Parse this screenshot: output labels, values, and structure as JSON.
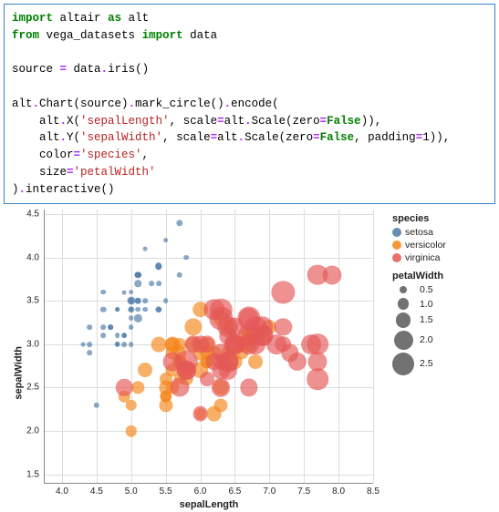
{
  "code": {
    "tokens": [
      [
        [
          "import",
          "kw"
        ],
        [
          " "
        ],
        [
          "altair",
          "name"
        ],
        [
          " "
        ],
        [
          "as",
          "kw"
        ],
        [
          " "
        ],
        [
          "alt",
          "name"
        ]
      ],
      [
        [
          "from",
          "kw"
        ],
        [
          " "
        ],
        [
          "vega_datasets",
          "name"
        ],
        [
          " "
        ],
        [
          "import",
          "kw"
        ],
        [
          " "
        ],
        [
          "data",
          "name"
        ]
      ],
      [],
      [
        [
          "source "
        ],
        [
          "=",
          "op"
        ],
        [
          " data"
        ],
        [
          ".",
          "op"
        ],
        [
          "iris()"
        ]
      ],
      [],
      [
        [
          "alt"
        ],
        [
          ".",
          "op"
        ],
        [
          "Chart(source)"
        ],
        [
          ".",
          "op"
        ],
        [
          "mark_circle()"
        ],
        [
          ".",
          "op"
        ],
        [
          "encode("
        ]
      ],
      [
        [
          "    alt"
        ],
        [
          ".",
          "op"
        ],
        [
          "X("
        ],
        [
          "'sepalLength'",
          "str"
        ],
        [
          ", scale"
        ],
        [
          "=",
          "op"
        ],
        [
          "alt"
        ],
        [
          ".",
          "op"
        ],
        [
          "Scale(zero"
        ],
        [
          "=",
          "op"
        ],
        [
          "False",
          "bool"
        ],
        [
          ")),"
        ]
      ],
      [
        [
          "    alt"
        ],
        [
          ".",
          "op"
        ],
        [
          "Y("
        ],
        [
          "'sepalWidth'",
          "str"
        ],
        [
          ", scale"
        ],
        [
          "=",
          "op"
        ],
        [
          "alt"
        ],
        [
          ".",
          "op"
        ],
        [
          "Scale(zero"
        ],
        [
          "=",
          "op"
        ],
        [
          "False",
          "bool"
        ],
        [
          ", padding"
        ],
        [
          "=",
          "op"
        ],
        [
          "1",
          "num"
        ],
        [
          ")),"
        ]
      ],
      [
        [
          "    color"
        ],
        [
          "=",
          "op"
        ],
        [
          "'species'",
          "str"
        ],
        [
          ","
        ]
      ],
      [
        [
          "    size"
        ],
        [
          "=",
          "op"
        ],
        [
          "'petalWidth'",
          "str"
        ]
      ],
      [
        [
          ")"
        ],
        [
          ".",
          "op"
        ],
        [
          "interactive()"
        ]
      ]
    ]
  },
  "chart_data": {
    "type": "scatter",
    "xlabel": "sepalLength",
    "ylabel": "sepalWidth",
    "x_ticks": [
      4.0,
      4.5,
      5.0,
      5.5,
      6.0,
      6.5,
      7.0,
      7.5,
      8.0,
      8.5
    ],
    "y_ticks": [
      1.5,
      2.0,
      2.5,
      3.0,
      3.5,
      4.0,
      4.5
    ],
    "xlim": [
      3.75,
      8.5
    ],
    "ylim": [
      1.4,
      4.55
    ],
    "color_field": "species",
    "size_field": "petalWidth",
    "colors": {
      "setosa": "#4c78a8",
      "versicolor": "#f58518",
      "virginica": "#e45756"
    },
    "legend_color": {
      "title": "species",
      "items": [
        "setosa",
        "versicolor",
        "virginica"
      ]
    },
    "legend_size": {
      "title": "petalWidth",
      "items": [
        0.5,
        1.0,
        1.5,
        2.0,
        2.5
      ]
    },
    "series": [
      {
        "species": "setosa",
        "color": "#4c78a8",
        "points": [
          [
            5.1,
            3.5,
            0.2
          ],
          [
            4.9,
            3.0,
            0.2
          ],
          [
            4.7,
            3.2,
            0.2
          ],
          [
            4.6,
            3.1,
            0.2
          ],
          [
            5.0,
            3.6,
            0.2
          ],
          [
            5.4,
            3.9,
            0.4
          ],
          [
            4.6,
            3.4,
            0.3
          ],
          [
            5.0,
            3.4,
            0.2
          ],
          [
            4.4,
            2.9,
            0.2
          ],
          [
            4.9,
            3.1,
            0.1
          ],
          [
            5.4,
            3.7,
            0.2
          ],
          [
            4.8,
            3.4,
            0.2
          ],
          [
            4.8,
            3.0,
            0.1
          ],
          [
            4.3,
            3.0,
            0.1
          ],
          [
            5.8,
            4.0,
            0.2
          ],
          [
            5.7,
            4.4,
            0.4
          ],
          [
            5.4,
            3.9,
            0.4
          ],
          [
            5.1,
            3.5,
            0.3
          ],
          [
            5.7,
            3.8,
            0.3
          ],
          [
            5.1,
            3.8,
            0.3
          ],
          [
            5.4,
            3.4,
            0.2
          ],
          [
            5.1,
            3.7,
            0.4
          ],
          [
            4.6,
            3.6,
            0.2
          ],
          [
            5.1,
            3.3,
            0.5
          ],
          [
            4.8,
            3.4,
            0.2
          ],
          [
            5.0,
            3.0,
            0.2
          ],
          [
            5.0,
            3.4,
            0.4
          ],
          [
            5.2,
            3.5,
            0.2
          ],
          [
            5.2,
            3.4,
            0.2
          ],
          [
            4.7,
            3.2,
            0.2
          ],
          [
            4.8,
            3.1,
            0.2
          ],
          [
            5.4,
            3.4,
            0.4
          ],
          [
            5.2,
            4.1,
            0.1
          ],
          [
            5.5,
            4.2,
            0.2
          ],
          [
            4.9,
            3.1,
            0.2
          ],
          [
            5.0,
            3.2,
            0.2
          ],
          [
            5.5,
            3.5,
            0.2
          ],
          [
            4.9,
            3.6,
            0.1
          ],
          [
            4.4,
            3.0,
            0.2
          ],
          [
            5.1,
            3.4,
            0.2
          ],
          [
            5.0,
            3.5,
            0.3
          ],
          [
            4.5,
            2.3,
            0.3
          ],
          [
            4.4,
            3.2,
            0.2
          ],
          [
            5.0,
            3.5,
            0.6
          ],
          [
            5.1,
            3.8,
            0.4
          ],
          [
            4.8,
            3.0,
            0.3
          ],
          [
            5.1,
            3.8,
            0.2
          ],
          [
            4.6,
            3.2,
            0.2
          ],
          [
            5.3,
            3.7,
            0.2
          ],
          [
            5.0,
            3.3,
            0.2
          ]
        ]
      },
      {
        "species": "versicolor",
        "color": "#f58518",
        "points": [
          [
            7.0,
            3.2,
            1.4
          ],
          [
            6.4,
            3.2,
            1.5
          ],
          [
            6.9,
            3.1,
            1.5
          ],
          [
            5.5,
            2.3,
            1.3
          ],
          [
            6.5,
            2.8,
            1.5
          ],
          [
            5.7,
            2.8,
            1.3
          ],
          [
            6.3,
            3.3,
            1.6
          ],
          [
            4.9,
            2.4,
            1.0
          ],
          [
            6.6,
            2.9,
            1.3
          ],
          [
            5.2,
            2.7,
            1.4
          ],
          [
            5.0,
            2.0,
            1.0
          ],
          [
            5.9,
            3.0,
            1.5
          ],
          [
            6.0,
            2.2,
            1.0
          ],
          [
            6.1,
            2.9,
            1.4
          ],
          [
            5.6,
            2.9,
            1.3
          ],
          [
            6.7,
            3.1,
            1.4
          ],
          [
            5.6,
            3.0,
            1.5
          ],
          [
            5.8,
            2.7,
            1.0
          ],
          [
            6.2,
            2.2,
            1.5
          ],
          [
            5.6,
            2.5,
            1.1
          ],
          [
            5.9,
            3.2,
            1.8
          ],
          [
            6.1,
            2.8,
            1.3
          ],
          [
            6.3,
            2.5,
            1.5
          ],
          [
            6.1,
            2.8,
            1.2
          ],
          [
            6.4,
            2.9,
            1.3
          ],
          [
            6.6,
            3.0,
            1.4
          ],
          [
            6.8,
            2.8,
            1.4
          ],
          [
            6.7,
            3.0,
            1.7
          ],
          [
            6.0,
            2.9,
            1.5
          ],
          [
            5.7,
            2.6,
            1.0
          ],
          [
            5.5,
            2.4,
            1.1
          ],
          [
            5.5,
            2.4,
            1.0
          ],
          [
            5.8,
            2.7,
            1.2
          ],
          [
            6.0,
            2.7,
            1.6
          ],
          [
            5.4,
            3.0,
            1.5
          ],
          [
            6.0,
            3.4,
            1.6
          ],
          [
            6.7,
            3.1,
            1.5
          ],
          [
            6.3,
            2.3,
            1.3
          ],
          [
            5.6,
            3.0,
            1.3
          ],
          [
            5.5,
            2.5,
            1.3
          ],
          [
            5.5,
            2.6,
            1.2
          ],
          [
            6.1,
            3.0,
            1.4
          ],
          [
            5.8,
            2.6,
            1.2
          ],
          [
            5.0,
            2.3,
            1.0
          ],
          [
            5.6,
            2.7,
            1.3
          ],
          [
            5.7,
            3.0,
            1.2
          ],
          [
            5.7,
            2.9,
            1.3
          ],
          [
            6.2,
            2.9,
            1.3
          ],
          [
            5.1,
            2.5,
            1.1
          ],
          [
            5.7,
            2.8,
            1.3
          ]
        ]
      },
      {
        "species": "virginica",
        "color": "#e45756",
        "points": [
          [
            6.3,
            3.3,
            2.5
          ],
          [
            5.8,
            2.7,
            1.9
          ],
          [
            7.1,
            3.0,
            2.1
          ],
          [
            6.3,
            2.9,
            1.8
          ],
          [
            6.5,
            3.0,
            2.2
          ],
          [
            7.6,
            3.0,
            2.1
          ],
          [
            4.9,
            2.5,
            1.7
          ],
          [
            7.3,
            2.9,
            1.8
          ],
          [
            6.7,
            2.5,
            1.8
          ],
          [
            7.2,
            3.6,
            2.5
          ],
          [
            6.5,
            3.2,
            2.0
          ],
          [
            6.4,
            2.7,
            1.9
          ],
          [
            6.8,
            3.0,
            2.1
          ],
          [
            5.7,
            2.5,
            2.0
          ],
          [
            5.8,
            2.8,
            2.4
          ],
          [
            6.4,
            3.2,
            2.3
          ],
          [
            6.5,
            3.0,
            1.8
          ],
          [
            7.7,
            3.8,
            2.2
          ],
          [
            7.7,
            2.6,
            2.3
          ],
          [
            6.0,
            2.2,
            1.5
          ],
          [
            6.9,
            3.2,
            2.3
          ],
          [
            5.6,
            2.8,
            2.0
          ],
          [
            7.7,
            2.8,
            2.0
          ],
          [
            6.3,
            2.7,
            1.8
          ],
          [
            6.7,
            3.3,
            2.1
          ],
          [
            7.2,
            3.2,
            1.8
          ],
          [
            6.2,
            2.8,
            1.8
          ],
          [
            6.1,
            3.0,
            1.8
          ],
          [
            6.4,
            2.8,
            2.1
          ],
          [
            7.2,
            3.0,
            1.6
          ],
          [
            7.4,
            2.8,
            1.9
          ],
          [
            7.9,
            3.8,
            2.0
          ],
          [
            6.4,
            2.8,
            2.2
          ],
          [
            6.3,
            2.8,
            1.5
          ],
          [
            6.1,
            2.6,
            1.4
          ],
          [
            7.7,
            3.0,
            2.3
          ],
          [
            6.3,
            3.4,
            2.4
          ],
          [
            6.4,
            3.1,
            1.8
          ],
          [
            6.0,
            3.0,
            1.8
          ],
          [
            6.9,
            3.1,
            2.1
          ],
          [
            6.7,
            3.1,
            2.4
          ],
          [
            6.9,
            3.1,
            2.3
          ],
          [
            5.8,
            2.7,
            1.9
          ],
          [
            6.8,
            3.2,
            2.3
          ],
          [
            6.7,
            3.3,
            2.5
          ],
          [
            6.7,
            3.0,
            2.3
          ],
          [
            6.3,
            2.5,
            1.9
          ],
          [
            6.5,
            3.0,
            2.0
          ],
          [
            6.2,
            3.4,
            2.3
          ],
          [
            5.9,
            3.0,
            1.8
          ]
        ]
      }
    ]
  }
}
